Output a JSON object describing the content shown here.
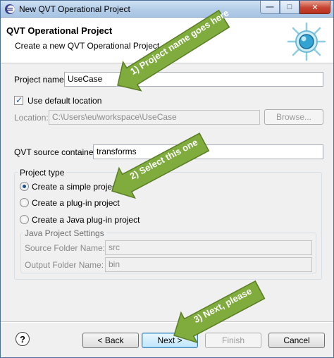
{
  "window": {
    "title": "New QVT Operational Project"
  },
  "header": {
    "title": "QVT Operational Project",
    "description": "Create a new QVT Operational Project"
  },
  "project_name": {
    "label": "Project name:",
    "value": "UseCase"
  },
  "use_default_location": {
    "label": "Use default location",
    "checked": true
  },
  "location": {
    "label": "Location:",
    "value": "C:\\Users\\eu\\workspace\\UseCase",
    "browse_label": "Browse..."
  },
  "source_container": {
    "label": "QVT source container:",
    "value": "transforms"
  },
  "project_type": {
    "title": "Project type",
    "options": [
      {
        "label": "Create a simple project",
        "selected": true
      },
      {
        "label": "Create a plug-in project",
        "selected": false
      },
      {
        "label": "Create a Java plug-in project",
        "selected": false
      }
    ]
  },
  "java_settings": {
    "title": "Java Project Settings",
    "source_folder": {
      "label": "Source Folder Name:",
      "value": "src"
    },
    "output_folder": {
      "label": "Output Folder Name:",
      "value": "bin"
    }
  },
  "buttons": {
    "help": "?",
    "back": "< Back",
    "next": "Next >",
    "finish": "Finish",
    "cancel": "Cancel"
  },
  "annotations": [
    {
      "text": "1) Project name goes here"
    },
    {
      "text": "2) Select this one"
    },
    {
      "text": "3) Next, please"
    }
  ],
  "colors": {
    "callout_green": "#7fac3c",
    "callout_border": "#5a7d25",
    "accent_blue": "#3c7fb1"
  }
}
